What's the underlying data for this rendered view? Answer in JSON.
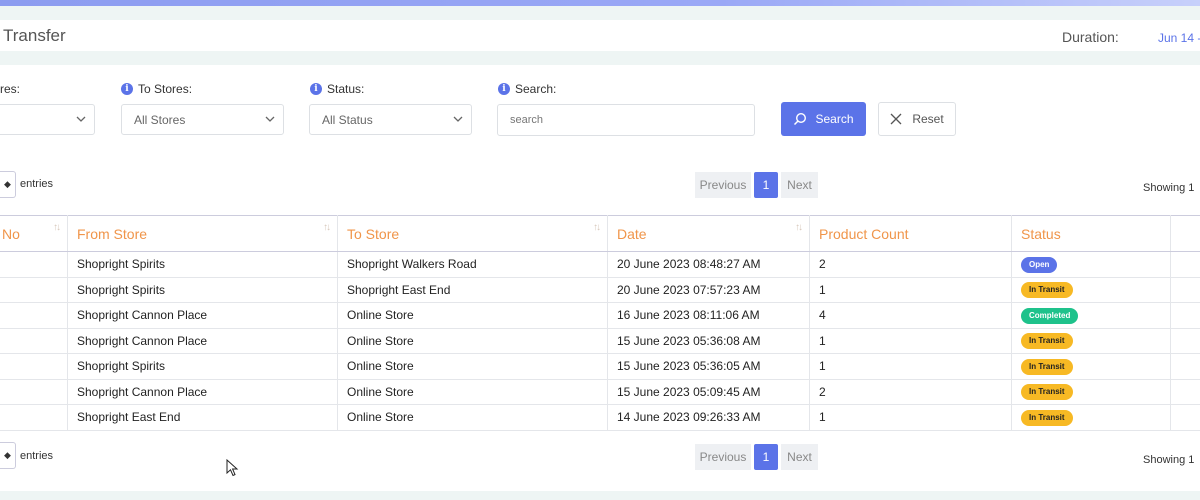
{
  "header": {
    "title": "Transfer",
    "duration_label": "Duration:",
    "duration_value": "Jun 14 -"
  },
  "filters": {
    "from_label": "res:",
    "to_label": "To Stores:",
    "to_value": "All Stores",
    "status_label": "Status:",
    "status_value": "All Status",
    "search_label": "Search:",
    "search_placeholder": "search",
    "search_button": "Search",
    "reset_button": "Reset"
  },
  "table_controls": {
    "entries_label": "entries",
    "previous": "Previous",
    "page": "1",
    "next": "Next",
    "showing": "Showing 1"
  },
  "table": {
    "headers": [
      "No",
      "From Store",
      "To Store",
      "Date",
      "Product Count",
      "Status",
      ""
    ],
    "rows": [
      {
        "from": "Shopright Spirits",
        "to": "Shopright Walkers Road",
        "date": "20 June 2023 08:48:27 AM",
        "count": "2",
        "status": "Open"
      },
      {
        "from": "Shopright Spirits",
        "to": "Shopright East End",
        "date": "20 June 2023 07:57:23 AM",
        "count": "1",
        "status": "In Transit"
      },
      {
        "from": "Shopright Cannon Place",
        "to": "Online Store",
        "date": "16 June 2023 08:11:06 AM",
        "count": "4",
        "status": "Completed"
      },
      {
        "from": "Shopright Cannon Place",
        "to": "Online Store",
        "date": "15 June 2023 05:36:08 AM",
        "count": "1",
        "status": "In Transit"
      },
      {
        "from": "Shopright Spirits",
        "to": "Online Store",
        "date": "15 June 2023 05:36:05 AM",
        "count": "1",
        "status": "In Transit"
      },
      {
        "from": "Shopright Cannon Place",
        "to": "Online Store",
        "date": "15 June 2023 05:09:45 AM",
        "count": "2",
        "status": "In Transit"
      },
      {
        "from": "Shopright East End",
        "to": "Online Store",
        "date": "14 June 2023 09:26:33 AM",
        "count": "1",
        "status": "In Transit"
      }
    ]
  },
  "colors": {
    "accent": "#5b73e8",
    "header_text": "#f0954a",
    "open": "#5b73e8",
    "in_transit": "#f7b924",
    "completed": "#1ec28b"
  }
}
